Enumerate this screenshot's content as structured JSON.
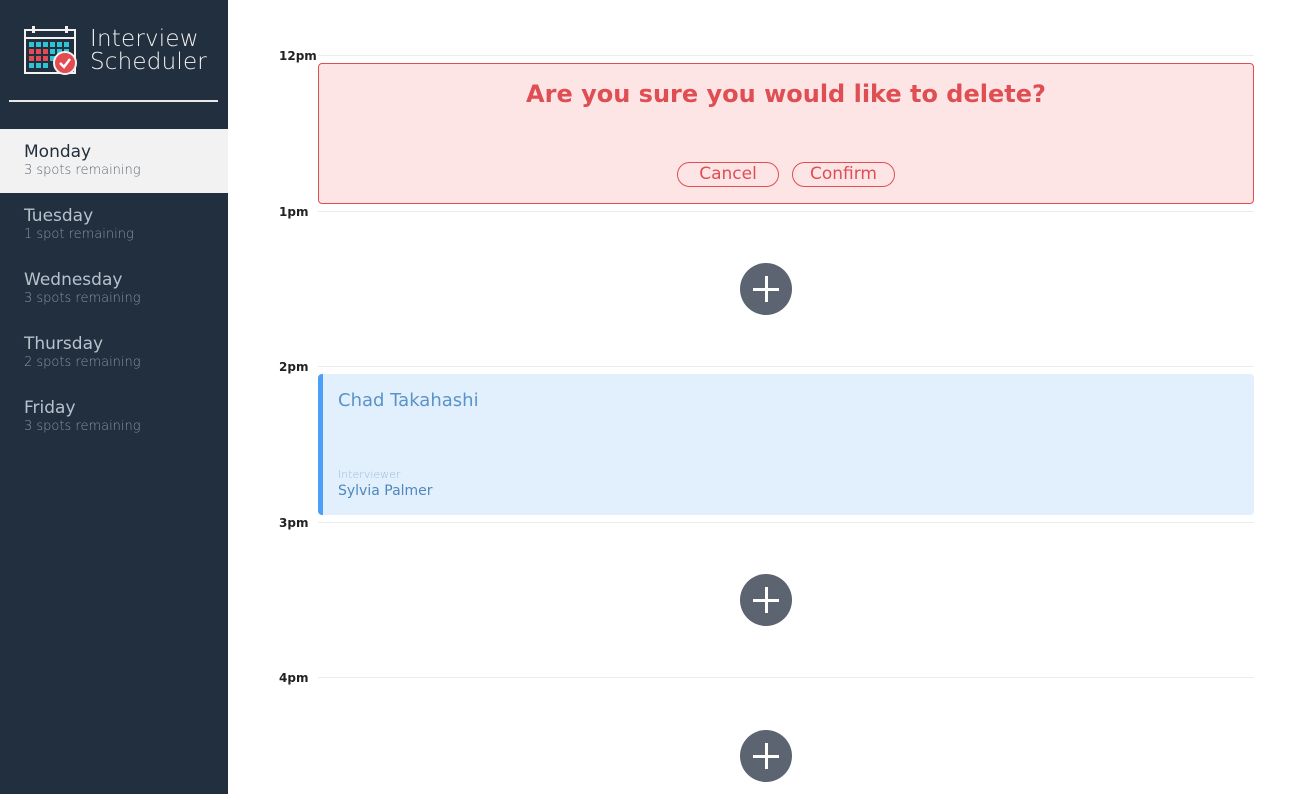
{
  "app": {
    "title_line1": "Interview",
    "title_line2": "Scheduler",
    "logo_icon": "calendar-check-icon"
  },
  "sidebar": {
    "days": [
      {
        "name": "Monday",
        "spots": "3 spots remaining",
        "selected": true
      },
      {
        "name": "Tuesday",
        "spots": "1 spot remaining",
        "selected": false
      },
      {
        "name": "Wednesday",
        "spots": "3 spots remaining",
        "selected": false
      },
      {
        "name": "Thursday",
        "spots": "2 spots remaining",
        "selected": false
      },
      {
        "name": "Friday",
        "spots": "3 spots remaining",
        "selected": false
      }
    ]
  },
  "schedule": {
    "times": [
      "12pm",
      "1pm",
      "2pm",
      "3pm",
      "4pm"
    ],
    "confirm": {
      "message": "Are you sure you would like to delete?",
      "cancel_label": "Cancel",
      "confirm_label": "Confirm"
    },
    "appointment": {
      "student": "Chad Takahashi",
      "interviewer_label": "Interviewer",
      "interviewer": "Sylvia Palmer"
    }
  },
  "colors": {
    "sidebar_bg": "#222f3e",
    "danger": "#df4e53",
    "danger_bg": "#fde5e6",
    "appointment_bg": "#e2f0fd",
    "appointment_accent": "#4b9ff6",
    "add_button": "#5b6470"
  }
}
